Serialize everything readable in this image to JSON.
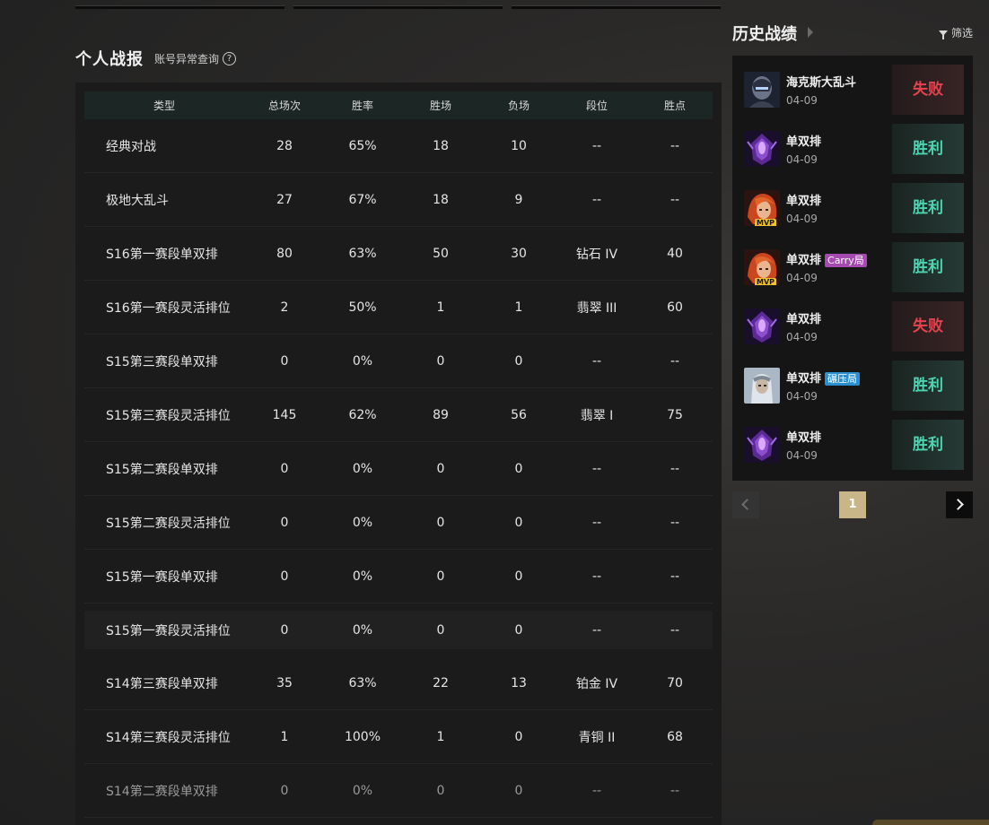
{
  "stats": {
    "title": "个人战报",
    "account_check": "账号异常查询",
    "help": "?",
    "headers": [
      "类型",
      "总场次",
      "胜率",
      "胜场",
      "负场",
      "段位",
      "胜点"
    ],
    "rows": [
      [
        "经典对战",
        "28",
        "65%",
        "18",
        "10",
        "--",
        "--"
      ],
      [
        "极地大乱斗",
        "27",
        "67%",
        "18",
        "9",
        "--",
        "--"
      ],
      [
        "S16第一赛段单双排",
        "80",
        "63%",
        "50",
        "30",
        "钻石 IV",
        "40"
      ],
      [
        "S16第一赛段灵活排位",
        "2",
        "50%",
        "1",
        "1",
        "翡翠 III",
        "60"
      ],
      [
        "S15第三赛段单双排",
        "0",
        "0%",
        "0",
        "0",
        "--",
        "--"
      ],
      [
        "S15第三赛段灵活排位",
        "145",
        "62%",
        "89",
        "56",
        "翡翠 I",
        "75"
      ],
      [
        "S15第二赛段单双排",
        "0",
        "0%",
        "0",
        "0",
        "--",
        "--"
      ],
      [
        "S15第二赛段灵活排位",
        "0",
        "0%",
        "0",
        "0",
        "--",
        "--"
      ],
      [
        "S15第一赛段单双排",
        "0",
        "0%",
        "0",
        "0",
        "--",
        "--"
      ],
      [
        "S15第一赛段灵活排位",
        "0",
        "0%",
        "0",
        "0",
        "--",
        "--"
      ],
      [
        "S14第三赛段单双排",
        "35",
        "63%",
        "22",
        "13",
        "铂金 IV",
        "70"
      ],
      [
        "S14第三赛段灵活排位",
        "1",
        "100%",
        "1",
        "0",
        "青铜 II",
        "68"
      ],
      [
        "S14第二赛段单双排",
        "0",
        "0%",
        "0",
        "0",
        "--",
        "--"
      ]
    ]
  },
  "history": {
    "title": "历史战绩",
    "filter_label": "筛选",
    "matches": [
      {
        "mode": "海克斯大乱斗",
        "tag": "",
        "date": "04-09",
        "result": "失败",
        "win": false,
        "champion_icon": "dark-knight-portrait",
        "mvp": ""
      },
      {
        "mode": "单双排",
        "tag": "",
        "date": "04-09",
        "result": "胜利",
        "win": true,
        "champion_icon": "void-purple-portrait",
        "mvp": ""
      },
      {
        "mode": "单双排",
        "tag": "",
        "date": "04-09",
        "result": "胜利",
        "win": true,
        "champion_icon": "red-hair-portrait",
        "mvp": "MVP"
      },
      {
        "mode": "单双排",
        "tag": "Carry局",
        "tag_type": "carry",
        "date": "04-09",
        "result": "胜利",
        "win": true,
        "champion_icon": "red-hair-portrait",
        "mvp": "MVP"
      },
      {
        "mode": "单双排",
        "tag": "",
        "date": "04-09",
        "result": "失败",
        "win": false,
        "champion_icon": "void-purple-portrait",
        "mvp": ""
      },
      {
        "mode": "单双排",
        "tag": "碾压局",
        "tag_type": "crush",
        "date": "04-09",
        "result": "胜利",
        "win": true,
        "champion_icon": "silver-knight-portrait",
        "mvp": ""
      },
      {
        "mode": "单双排",
        "tag": "",
        "date": "04-09",
        "result": "胜利",
        "win": true,
        "champion_icon": "void-purple-portrait",
        "mvp": ""
      }
    ],
    "pager": {
      "current": "1"
    }
  },
  "colors": {
    "win": "#4fd4b2",
    "lose": "#e2434e",
    "page_active": "#c8b688",
    "carry_tag": "#a54ab0",
    "crush_tag": "#2a8fcf"
  }
}
